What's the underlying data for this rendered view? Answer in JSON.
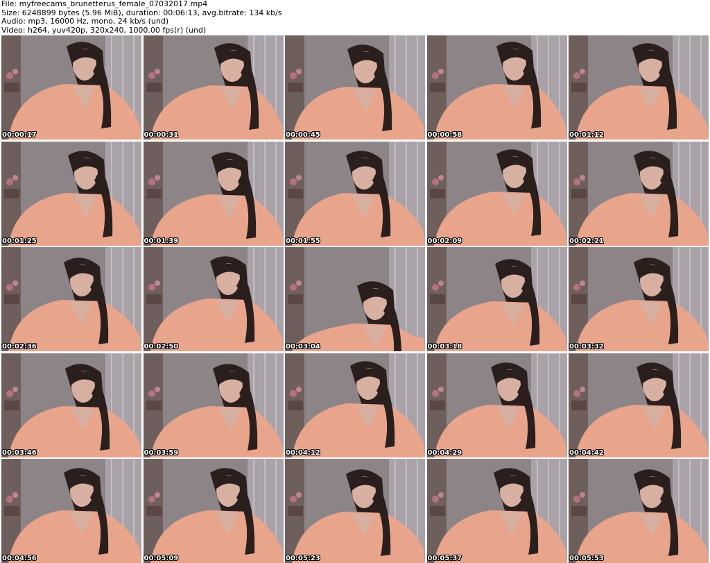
{
  "header": {
    "file_line": "File: myfreecams_brunetterus_female_07032017.mp4",
    "size_line": "Size: 6248899 bytes (5.96 MiB), duration: 00:06:13, avg.bitrate: 134 kb/s",
    "audio_line": "Audio: mp3, 16000 Hz, mono, 24 kb/s (und)",
    "video_line": "Video: h264, yuv420p, 320x240, 1000.00 fps(r) (und)"
  },
  "thumbnails": [
    {
      "timestamp": "00:00:17"
    },
    {
      "timestamp": "00:00:31"
    },
    {
      "timestamp": "00:00:45"
    },
    {
      "timestamp": "00:00:58"
    },
    {
      "timestamp": "00:01:12"
    },
    {
      "timestamp": "00:01:25"
    },
    {
      "timestamp": "00:01:39"
    },
    {
      "timestamp": "00:01:55"
    },
    {
      "timestamp": "00:02:09"
    },
    {
      "timestamp": "00:02:21"
    },
    {
      "timestamp": "00:02:36"
    },
    {
      "timestamp": "00:02:50"
    },
    {
      "timestamp": "00:03:04"
    },
    {
      "timestamp": "00:03:18"
    },
    {
      "timestamp": "00:03:32"
    },
    {
      "timestamp": "00:03:46"
    },
    {
      "timestamp": "00:03:59"
    },
    {
      "timestamp": "00:04:12"
    },
    {
      "timestamp": "00:04:29"
    },
    {
      "timestamp": "00:04:42"
    },
    {
      "timestamp": "00:04:56"
    },
    {
      "timestamp": "00:05:09"
    },
    {
      "timestamp": "00:05:23"
    },
    {
      "timestamp": "00:05:37"
    },
    {
      "timestamp": "00:05:53"
    }
  ],
  "colors": {
    "wall": "#8d8488",
    "curtain": "#a9a2a8",
    "robe": "#e9a48c",
    "hair": "#2a1f1d",
    "skin": "#d8b0a2",
    "timestamp_text": "#ffffff"
  }
}
